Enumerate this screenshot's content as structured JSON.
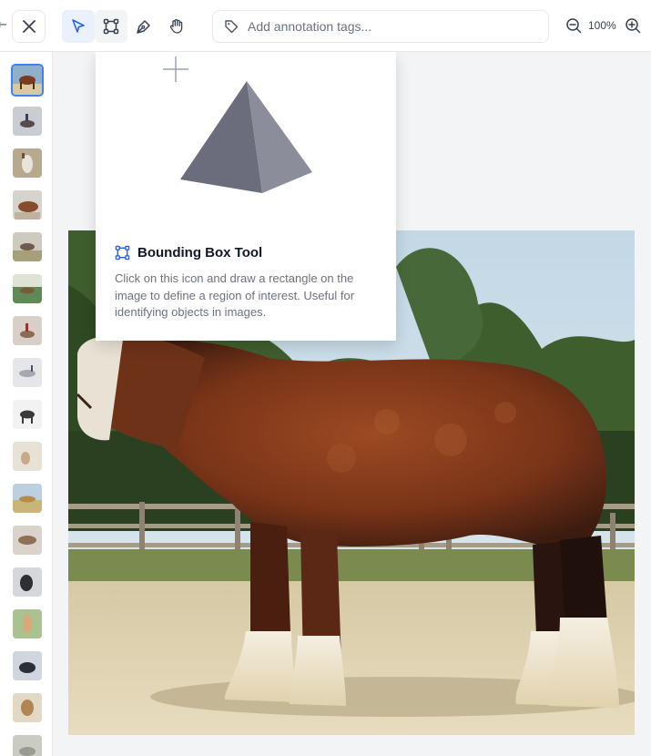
{
  "toolbar": {
    "back_icon": "arrow-left-icon",
    "close_icon": "close-icon",
    "tools": [
      {
        "name": "select-tool",
        "icon": "pointer-arrow-icon",
        "active": true
      },
      {
        "name": "bounding-box-tool",
        "icon": "bounding-box-icon",
        "active": false
      },
      {
        "name": "polygon-tool",
        "icon": "pen-tool-icon",
        "active": false
      },
      {
        "name": "pan-tool",
        "icon": "hand-icon",
        "active": false
      }
    ],
    "tags": {
      "placeholder": "Add annotation tags...",
      "value": "",
      "icon": "tag-icon"
    },
    "zoom": {
      "level": "100%",
      "out_icon": "zoom-out-icon",
      "in_icon": "zoom-in-icon"
    }
  },
  "tooltip": {
    "title": "Bounding Box Tool",
    "icon": "bounding-box-icon",
    "description": "Click on this icon and draw a rectangle on the image to define a region of interest. Useful for identifying objects in images."
  },
  "thumbnails": {
    "count": 17,
    "selected_index": 0
  },
  "colors": {
    "accent": "#2563eb",
    "active_bg": "#eaf1fd",
    "border": "#e5e7eb",
    "text_muted": "#6b7280"
  }
}
